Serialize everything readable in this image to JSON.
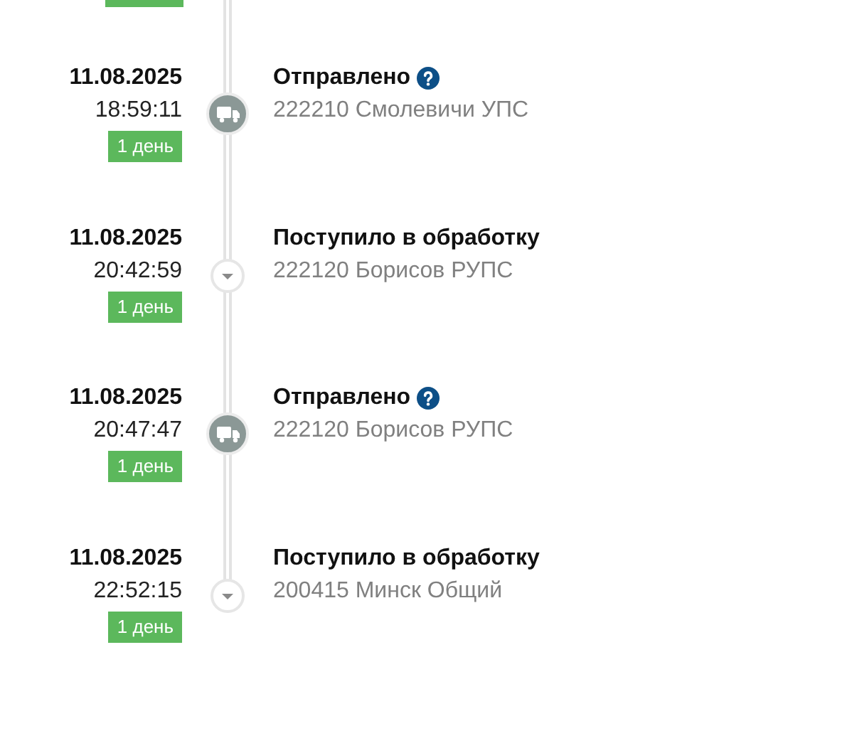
{
  "events": [
    {
      "kind": "shipped",
      "date": "11.08.2025",
      "time": "18:59:11",
      "badge": "1 день",
      "title": "Отправлено",
      "help": true,
      "location": "222210 Смолевичи УПС"
    },
    {
      "kind": "processing",
      "date": "11.08.2025",
      "time": "20:42:59",
      "badge": "1 день",
      "title": "Поступило в обработку",
      "help": false,
      "location": "222120 Борисов РУПС"
    },
    {
      "kind": "shipped",
      "date": "11.08.2025",
      "time": "20:47:47",
      "badge": "1 день",
      "title": "Отправлено",
      "help": true,
      "location": "222120 Борисов РУПС"
    },
    {
      "kind": "processing",
      "date": "11.08.2025",
      "time": "22:52:15",
      "badge": "1 день",
      "title": "Поступило в обработку",
      "help": false,
      "location": "200415 Минск Общий"
    }
  ]
}
